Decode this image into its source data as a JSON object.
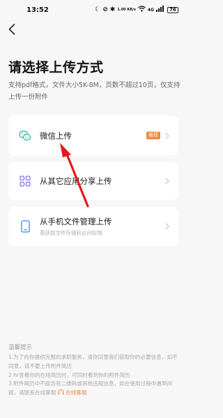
{
  "status_bar": {
    "time": "13:52",
    "network_speed": "1.00 KB/s",
    "network_type": "4G",
    "battery": "76",
    "icons": [
      "moon-icon",
      "do-not-disturb-icon",
      "bluetooth-icon",
      "wifi-icon",
      "signal-icon",
      "battery-icon"
    ]
  },
  "header": {
    "back_icon": "chevron-left-icon"
  },
  "page": {
    "title": "请选择上传方式",
    "description": "支持pdf格式，文件大小5K-8M，页数不超过10页，仅支持上传一份附件"
  },
  "options": [
    {
      "label": "微信上传",
      "subtitle": "",
      "badge": "推荐",
      "icon": "wechat-icon"
    },
    {
      "label": "从其它应用分享上传",
      "subtitle": "",
      "badge": "",
      "icon": "app-grid-icon"
    },
    {
      "label": "从手机文件管理上传",
      "subtitle": "需获取文件存储和访问权限",
      "badge": "",
      "icon": "phone-icon"
    }
  ],
  "tips": {
    "title": "温馨提示",
    "items": [
      "1.为了向你提供完整的求职服务，请你同意我们获取你的必要信息，如不同意，请不要上传附件简历",
      "2.hr查看你的在线简历时，可同时看到你的附件简历",
      "3.附件简历中不能含有二维码或其他违规信息，如在使用过程中遇到问题，请联系在线客服"
    ],
    "customer_service_label": "在线客服"
  },
  "colors": {
    "accent": "#3fb6a8",
    "orange": "#f08a3c",
    "purple": "#8a6cf2",
    "blue": "#3a8bf5",
    "annotation_red": "#e8191b"
  }
}
